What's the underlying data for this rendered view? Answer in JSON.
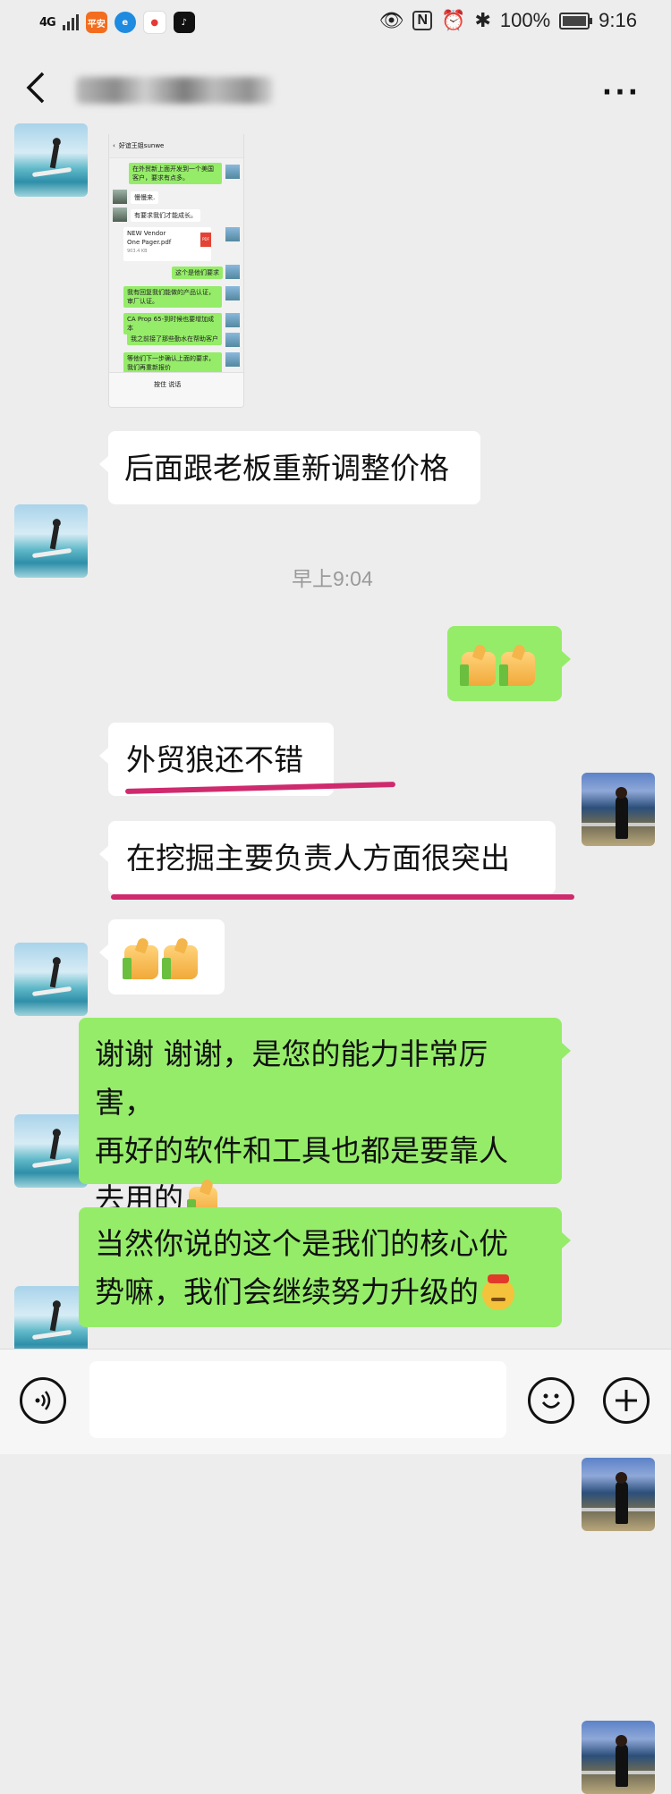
{
  "status_bar": {
    "network": "4G",
    "network_sub": "46",
    "apps": [
      {
        "name": "pingan-app-icon",
        "label": "平安",
        "color": "#f36d1f"
      },
      {
        "name": "browser-app-icon",
        "label": "e",
        "color": "#1e8be0"
      },
      {
        "name": "maps-app-icon",
        "label": "●",
        "color": "#e53935"
      },
      {
        "name": "tiktok-app-icon",
        "label": "♪",
        "color": "#111111"
      }
    ],
    "battery": "100%",
    "time": "9:16"
  },
  "header": {
    "back_icon": "chevron-left-icon",
    "more_label": "···"
  },
  "screenshot_message": {
    "title": "好谊王姐sunwe",
    "items": [
      {
        "side": "right",
        "text": "在外贸新上面开发到一个美国客户，要求有点多。"
      },
      {
        "side": "left",
        "text": "慢慢来."
      },
      {
        "side": "left",
        "text": "有要求我们才能成长。"
      },
      {
        "side": "left",
        "file_name": "NEW Vendor One Pager.pdf",
        "file_size": "903.4 KB"
      },
      {
        "side": "right",
        "text": "这个是他们要求"
      },
      {
        "side": "right",
        "text": "我有回复我们能做的产品认证，审厂认证。"
      },
      {
        "side": "right",
        "text": "CA Prop 65-到时候也要增加成本"
      },
      {
        "side": "right",
        "text": "我之前接了那些勤水在帮助客户"
      },
      {
        "side": "right",
        "text": "等他们下一步确认上面的要求，我们再重新报价"
      }
    ],
    "hold_to_talk": "按住 说话"
  },
  "messages": {
    "m1": "后面跟老板重新调整价格",
    "timestamp": "早上9:04",
    "m3": "外贸狼还不错",
    "m4": "在挖掘主要负责人方面很突出",
    "m6_line1": "谢谢 谢谢，是您的能力非常厉害，",
    "m6_line2": "再好的软件和工具也都是要靠人",
    "m6_line3": "去用的",
    "m7_line1": "当然你说的这个是我们的核心优",
    "m7_line2": "势嘛，我们会继续努力升级的"
  },
  "colors": {
    "background": "#ededed",
    "outgoing_bubble": "#95ec69",
    "incoming_bubble": "#ffffff",
    "underline": "#cf2a6e"
  },
  "input_bar": {
    "voice_icon": "voice-icon",
    "emoji_icon": "emoji-icon",
    "plus_icon": "plus-icon",
    "text_value": ""
  }
}
